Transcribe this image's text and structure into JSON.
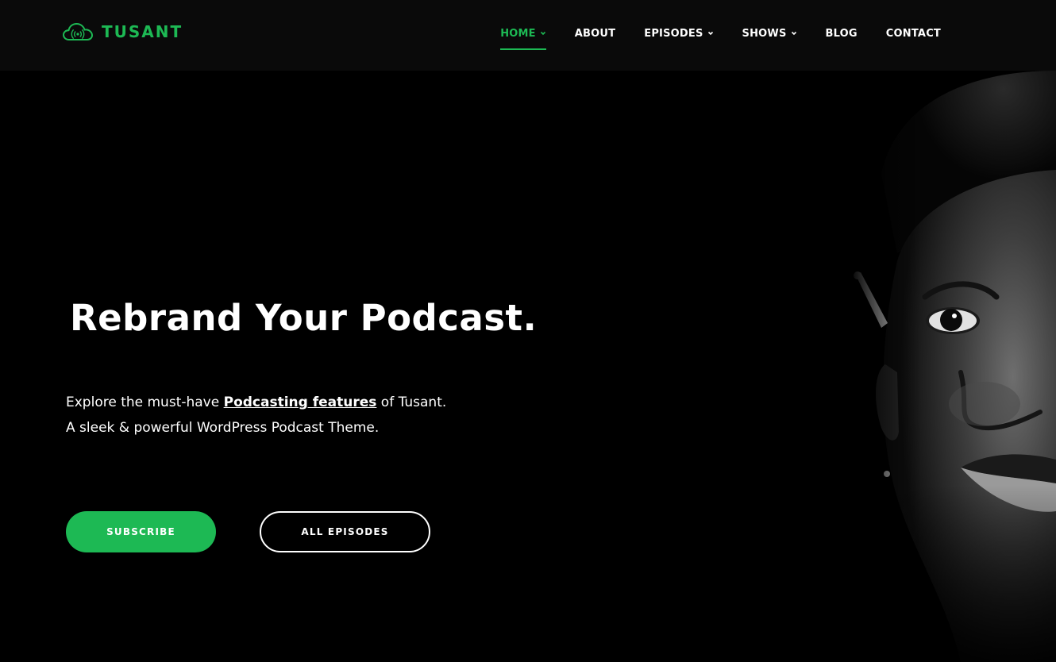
{
  "brand": {
    "name": "TUSANT",
    "accent_color": "#1db954",
    "logo_icon": "cloud-broadcast-icon"
  },
  "nav": {
    "items": [
      {
        "label": "HOME",
        "has_dropdown": true,
        "active": true
      },
      {
        "label": "ABOUT",
        "has_dropdown": false,
        "active": false
      },
      {
        "label": "EPISODES",
        "has_dropdown": true,
        "active": false
      },
      {
        "label": "SHOWS",
        "has_dropdown": true,
        "active": false
      },
      {
        "label": "BLOG",
        "has_dropdown": false,
        "active": false
      },
      {
        "label": "CONTACT",
        "has_dropdown": false,
        "active": false
      }
    ]
  },
  "hero": {
    "title": "Rebrand Your Podcast.",
    "desc_line1_prefix": "Explore the must-have ",
    "desc_link": "Podcasting features",
    "desc_line1_suffix": " of Tusant.",
    "desc_line2": "A sleek & powerful WordPress Podcast Theme.",
    "subscribe_label": "SUBSCRIBE",
    "episodes_label": "ALL EPISODES"
  }
}
